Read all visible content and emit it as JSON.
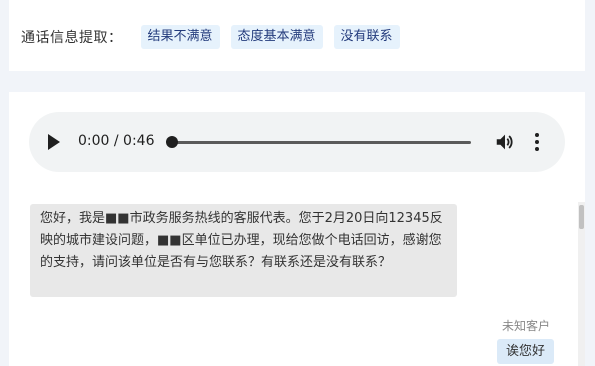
{
  "info": {
    "label": "通话信息提取：",
    "tags": [
      "结果不满意",
      "态度基本满意",
      "没有联系"
    ]
  },
  "audio": {
    "time": "0:00 / 0:46",
    "progress": 0
  },
  "chat": {
    "messages": [
      {
        "text": "您好，我是■■市政务服务热线的客服代表。您于2月20日向12345反映的城市建设问题，■■区单位已办理，现给您做个电话回访，感谢您的支持，请问该单位是否有与您联系？有联系还是没有联系？"
      }
    ],
    "reply": {
      "speaker": "未知客户",
      "text": "诶您好"
    }
  }
}
